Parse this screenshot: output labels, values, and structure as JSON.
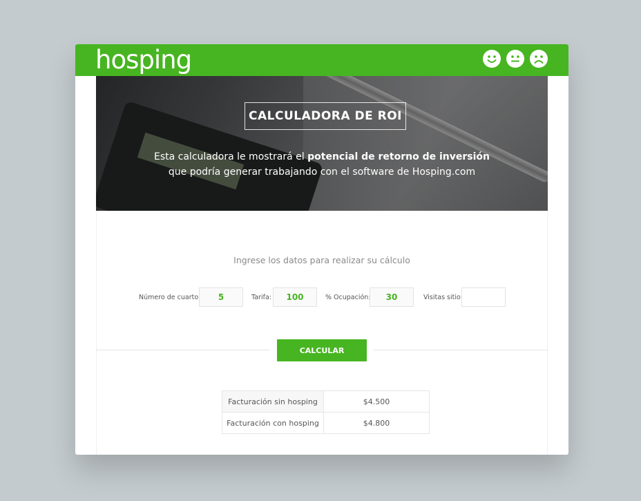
{
  "brand": {
    "logo_text": "hosping",
    "accent_color": "#47b521"
  },
  "feedback_icons": [
    "happy-face-icon",
    "neutral-face-icon",
    "sad-face-icon"
  ],
  "hero": {
    "title": "CALCULADORA DE ROI",
    "line1_pre": "Esta calculadora le mostrará el ",
    "line1_bold": "potencial de retorno de inversión",
    "line2": "que podría generar trabajando con el software de Hosping.com"
  },
  "form": {
    "prompt": "Ingrese los datos para realizar su cálculo",
    "fields": [
      {
        "label": "Número de cuarto:",
        "value": "5"
      },
      {
        "label": "Tarifa:",
        "value": "100"
      },
      {
        "label": "% Ocupación:",
        "value": "30"
      },
      {
        "label": "Visitas sitio:",
        "value": ""
      }
    ],
    "submit_label": "CALCULAR"
  },
  "results": [
    {
      "label": "Facturación sin hosping",
      "value": "$4.500"
    },
    {
      "label": "Facturación con hosping",
      "value": "$4.800"
    }
  ]
}
